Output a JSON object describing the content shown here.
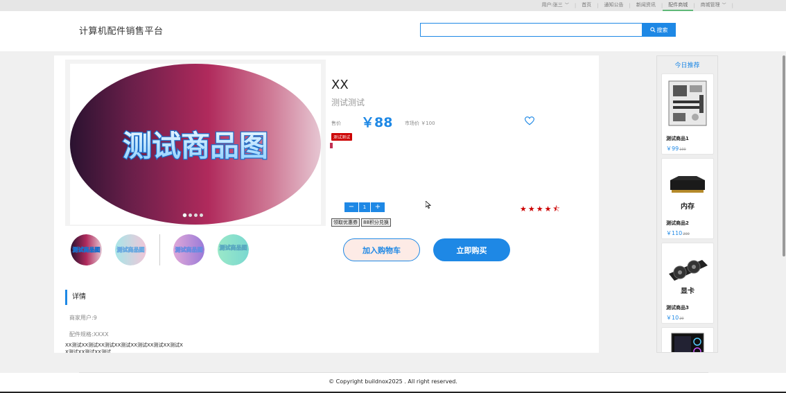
{
  "topnav": {
    "user": "用户:张三",
    "home": "首页",
    "notice": "通知公告",
    "news": "新闻资讯",
    "mall": "配件商城",
    "mall_manage": "商城管理"
  },
  "header": {
    "site_title": "计算机配件销售平台",
    "search_placeholder": "",
    "search_button": "搜索"
  },
  "product": {
    "banner_text": "测试商品图",
    "thumb_texts": [
      "测试商品图",
      "测试商品图",
      "测试商品图",
      "测试商品图"
    ],
    "title": "XX",
    "subtitle": "测试测试",
    "price_label": "售价",
    "price": "￥88",
    "market_price": "市场价 ￥100",
    "tag": "测试测试",
    "quantity": "1",
    "rating": 4.5,
    "coupon_label": "领取优惠券",
    "points_label": "88积分兑换",
    "add_cart": "加入购物车",
    "buy_now": "立即购买"
  },
  "details": {
    "heading": "详情",
    "merchant": "商家用户:9",
    "spec": "配件规格:XXXX",
    "description": "XX测试XX测试XX测试XX测试XX测试XX测试XX测试XX测试XX测试XX测试"
  },
  "sidebar": {
    "title": "今日推荐",
    "items": [
      {
        "name": "测试商品1",
        "price": "￥99",
        "old_price": "100",
        "image_label": ""
      },
      {
        "name": "测试商品2",
        "price": "￥110",
        "old_price": "200",
        "image_label": "内存"
      },
      {
        "name": "测试商品3",
        "price": "￥10",
        "old_price": "20",
        "image_label": "显卡"
      },
      {
        "name": "",
        "price": "",
        "old_price": "",
        "image_label": ""
      }
    ]
  },
  "footer": {
    "copyright": "© Copyright buildnox2025 . All right reserved."
  },
  "colors": {
    "accent": "#1e88e5",
    "tag_red": "#cc0000",
    "stars": "#cc0000"
  }
}
